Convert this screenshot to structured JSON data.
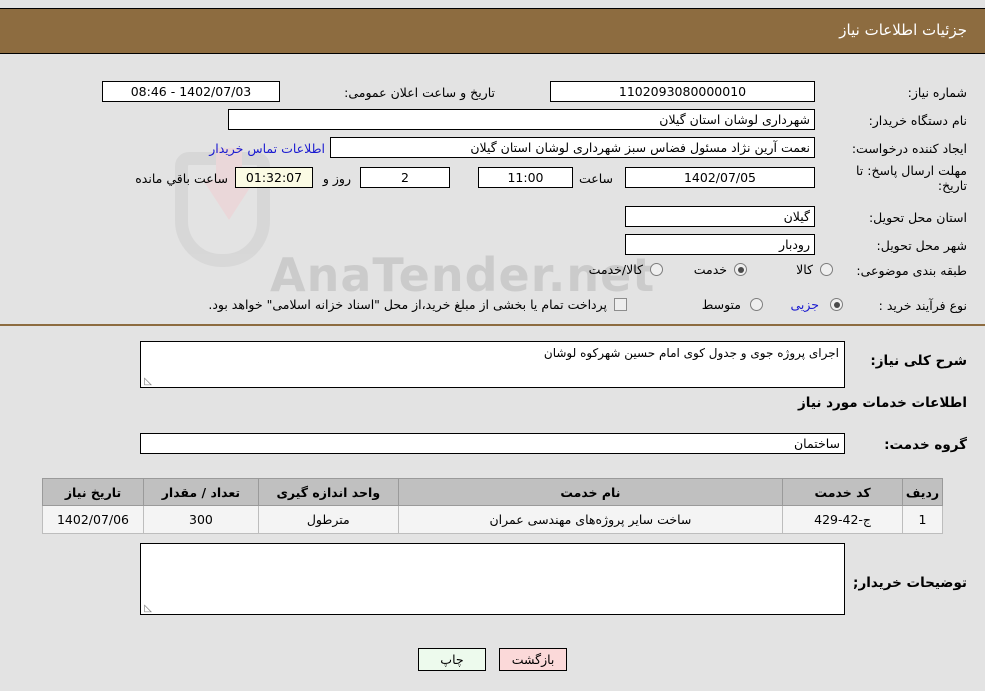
{
  "header": {
    "title": "جزئیات اطلاعات نیاز"
  },
  "form": {
    "need_number_label": "شماره نیاز:",
    "need_number_value": "1102093080000010",
    "announce_datetime_label": "تاریخ و ساعت اعلان عمومی:",
    "announce_datetime_value": "1402/07/03 - 08:46",
    "buyer_org_label": "نام دستگاه خریدار:",
    "buyer_org_value": "شهرداری لوشان استان گیلان",
    "requester_label": "ایجاد کننده درخواست:",
    "requester_value": "نعمت آرین نژاد مسئول فضاس سبز شهرداری لوشان استان گیلان",
    "contact_link": "اطلاعات تماس خریدار",
    "deadline_label": "مهلت ارسال پاسخ: تا تاریخ:",
    "deadline_date": "1402/07/05",
    "hour_label": "ساعت",
    "deadline_time": "11:00",
    "days_value": "2",
    "days_label": "روز و",
    "countdown_value": "01:32:07",
    "countdown_label": "ساعت باقي مانده",
    "province_label": "استان محل تحویل:",
    "province_value": "گیلان",
    "city_label": "شهر محل تحویل:",
    "city_value": "رودبار",
    "category_label": "طبقه بندی موضوعی:",
    "category_options": [
      "کالا",
      "خدمت",
      "کالا/خدمت"
    ],
    "category_selected": "خدمت",
    "process_label": "نوع فرآیند خرید :",
    "process_options": [
      "جزیی",
      "متوسط"
    ],
    "process_selected": "جزیی",
    "treasury_checkbox_label": "پرداخت تمام یا بخشی از مبلغ خرید،از محل \"اسناد خزانه اسلامی\" خواهد بود.",
    "treasury_checked": false
  },
  "need_desc": {
    "label": "شرح کلی نیاز:",
    "value": "اجرای پروژه جوی و جدول کوی امام حسین شهرکوه لوشان"
  },
  "services_section": {
    "title": "اطلاعات خدمات مورد نیاز",
    "group_label": "گروه خدمت:",
    "group_value": "ساختمان"
  },
  "table": {
    "columns": [
      "ردیف",
      "کد خدمت",
      "نام خدمت",
      "واحد اندازه گیری",
      "تعداد / مقدار",
      "تاریخ نیاز"
    ],
    "rows": [
      {
        "row": "1",
        "code": "ج-42-429",
        "name": "ساخت سایر پروژه‌های مهندسی عمران",
        "unit": "مترطول",
        "qty": "300",
        "date": "1402/07/06"
      }
    ]
  },
  "buyer_notes": {
    "label": "توضیحات خریدار;",
    "value": ""
  },
  "buttons": {
    "print": "چاپ",
    "back": "بازگشت"
  },
  "watermark": {
    "text": "AnaTender.net"
  },
  "colors": {
    "header_bg": "#8d6c40",
    "link": "#1a1ad0",
    "timer_bg": "#fbfbe4",
    "print_btn": "#edfaed",
    "back_btn": "#fbd9d9",
    "table_header": "#c0c0c0"
  }
}
